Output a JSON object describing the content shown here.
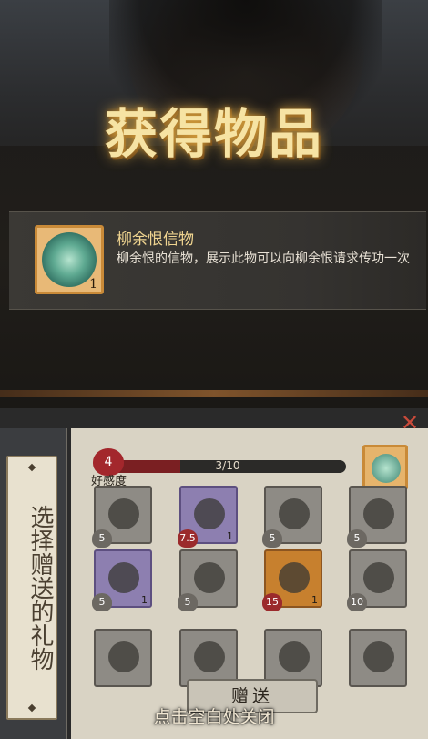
{
  "title": "获得物品",
  "item": {
    "name": "柳余恨信物",
    "description": "柳余恨的信物，展示此物可以向柳余恨请求传功一次",
    "quantity": "1"
  },
  "gift_panel": {
    "heading": "选择赠送的礼物",
    "favor_level": "4",
    "favor_label": "好感度",
    "favor_progress": "3/10",
    "favor_fraction": 0.3,
    "gift_button": "赠送"
  },
  "grid": [
    {
      "badge": "5",
      "count": "",
      "style": "gray",
      "badge_color": "gray"
    },
    {
      "badge": "7.5",
      "count": "1",
      "style": "purple",
      "badge_color": "red"
    },
    {
      "badge": "5",
      "count": "",
      "style": "gray",
      "badge_color": "gray"
    },
    {
      "badge": "5",
      "count": "",
      "style": "gray",
      "badge_color": "gray"
    },
    {
      "badge": "5",
      "count": "1",
      "style": "purple",
      "badge_color": "gray"
    },
    {
      "badge": "5",
      "count": "",
      "style": "gray",
      "badge_color": "gray"
    },
    {
      "badge": "15",
      "count": "1",
      "style": "gold",
      "badge_color": "red"
    },
    {
      "badge": "10",
      "count": "",
      "style": "gray",
      "badge_color": "gray"
    },
    {
      "badge": "",
      "count": "",
      "style": "gray",
      "badge_color": "gray"
    },
    {
      "badge": "",
      "count": "",
      "style": "gray",
      "badge_color": "gray"
    },
    {
      "badge": "",
      "count": "",
      "style": "gray",
      "badge_color": "gray"
    },
    {
      "badge": "",
      "count": "",
      "style": "gray",
      "badge_color": "gray"
    }
  ],
  "close_hint": "点击空白处关闭",
  "colors": {
    "accent_gold": "#f6e3a4",
    "favor_red": "#9b2a2c",
    "frame_orange": "#c98a38"
  }
}
